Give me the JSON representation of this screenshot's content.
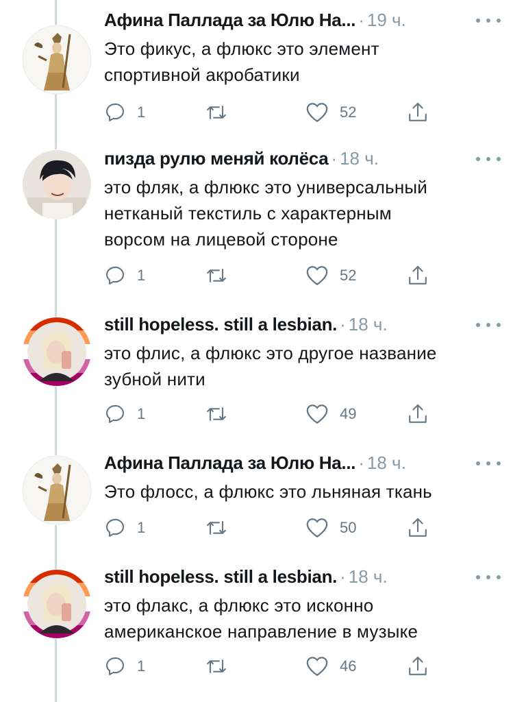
{
  "colors": {
    "text": "#14171a",
    "secondary": "#657786",
    "thread_line": "#cfd9de",
    "avatar_ring": [
      "#d52d00",
      "#ff9a56",
      "#ffffff",
      "#d362a4",
      "#a30262"
    ]
  },
  "tweets": [
    {
      "author": "Афина Паллада за Юлю На...",
      "time": "19 ч.",
      "text": "Это фикус, а флюкс это элемент\nспортивной акробатики",
      "replies": "1",
      "likes": "52",
      "avatar": "athena-statue-avatar"
    },
    {
      "author": "пизда рулю меняй колёса",
      "time": "18 ч.",
      "text": "это фляк, а флюкс это универсальный\nнетканый текстиль с характерным\nворсом на лицевой стороне",
      "replies": "1",
      "likes": "52",
      "avatar": "anime-boy-avatar"
    },
    {
      "author": "still hopeless. still a lesbian.",
      "time": "18 ч.",
      "text": "это флис, а флюкс это другое название\nзубной нити",
      "replies": "1",
      "likes": "49",
      "avatar": "selfie-avatar"
    },
    {
      "author": "Афина Паллада за Юлю На...",
      "time": "18 ч.",
      "text": "Это флосс, а флюкс это льняная ткань",
      "replies": "1",
      "likes": "50",
      "avatar": "athena-statue-avatar"
    },
    {
      "author": "still hopeless. still a lesbian.",
      "time": "18 ч.",
      "text": "это флакс, а флюкс это исконно\nамериканское направление в музыке",
      "replies": "1",
      "likes": "46",
      "avatar": "selfie-avatar"
    }
  ],
  "icons": {
    "reply": "reply-icon",
    "retweet": "retweet-icon",
    "like": "heart-icon",
    "share": "share-icon",
    "more": "more-dots-icon"
  }
}
